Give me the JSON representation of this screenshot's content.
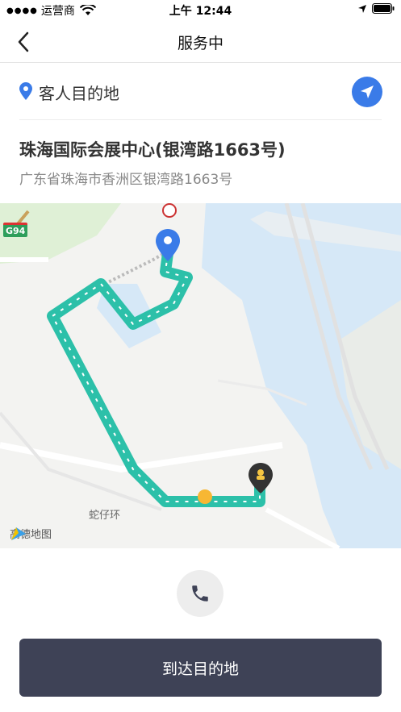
{
  "status_bar": {
    "carrier": "运营商",
    "time": "上午 12:44"
  },
  "nav": {
    "title": "服务中",
    "back_icon": "chevron-left-icon"
  },
  "destination": {
    "label": "客人目的地",
    "place_name": "珠海国际会展中心(银湾路1663号)",
    "address": "广东省珠海市香洲区银湾路1663号",
    "pin_color": "#3a7be8",
    "nav_icon": "navigation-arrow-icon"
  },
  "map": {
    "provider": "高德地图",
    "place_label": "蛇仔环",
    "highway": "G94",
    "route_color": "#2cc0a9"
  },
  "actions": {
    "phone_icon": "phone-icon",
    "arrive_label": "到达目的地",
    "arrive_color": "#3e4256"
  }
}
